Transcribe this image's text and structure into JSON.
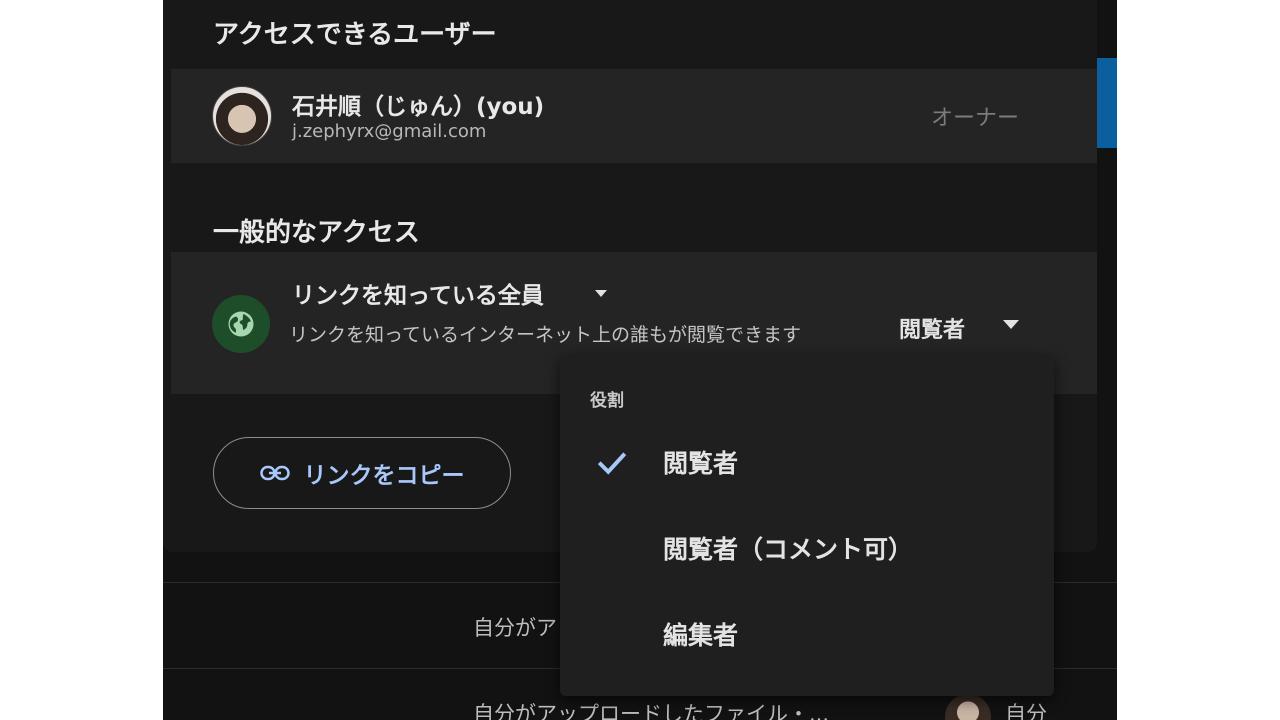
{
  "dialog": {
    "users_section_title": "アクセスできるユーザー",
    "owner": {
      "name": "石井順（じゅん）(you)",
      "email": "j.zephyrx@gmail.com",
      "role": "オーナー"
    },
    "general_section_title": "一般的なアクセス",
    "general_access": {
      "scope": "リンクを知っている全員",
      "description": "リンクを知っているインターネット上の誰もが閲覧できます",
      "role": "閲覧者"
    },
    "copy_link_label": "リンクをコピー"
  },
  "role_menu": {
    "header": "役割",
    "items": [
      {
        "label": "閲覧者",
        "selected": true
      },
      {
        "label": "閲覧者（コメント可）",
        "selected": false
      },
      {
        "label": "編集者",
        "selected": false
      }
    ]
  },
  "background": {
    "row1_text": "自分がア",
    "row2_text": "自分がアップロードしたファイル・...",
    "row2_owner": "自分"
  },
  "colors": {
    "accent": "#a8c7fa",
    "globe_bg": "#1e4d2a",
    "globe_fg": "#a6d8b0"
  }
}
